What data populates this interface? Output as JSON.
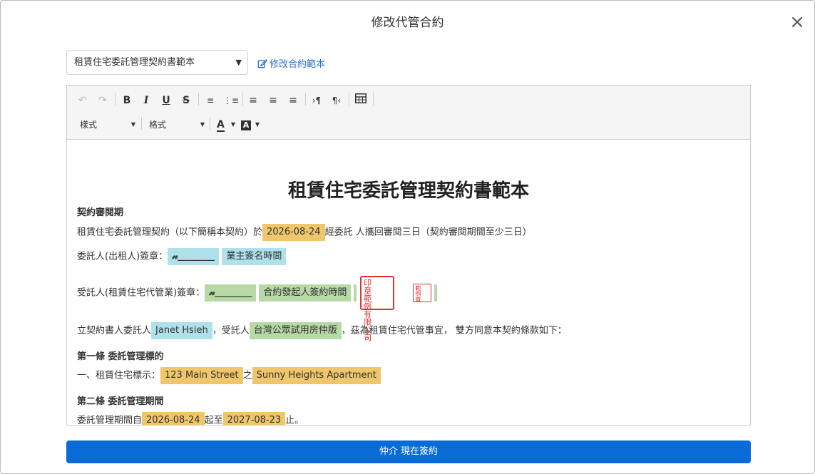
{
  "modal": {
    "title": "修改代管合約",
    "close": "×"
  },
  "template_select": {
    "value": "租賃住宅委託管理契約書範本",
    "edit_link": "修改合約範本"
  },
  "toolbar": {
    "style_dropdown": "樣式",
    "format_dropdown": "格式"
  },
  "document": {
    "title": "租賃住宅委託管理契約書範本",
    "review_heading": "契約審閱期",
    "review_text_1": "租賃住宅委託管理契約（以下簡稱本契約）於",
    "review_date": "2026-08-24",
    "review_text_2": "經委託 人攜回審閱三日（契約審閱期間至少三日）",
    "consignor_label": "委託人(出租人)簽章：",
    "consignor_sig": "𝓃________",
    "consignor_time": "業主簽名時間",
    "agent_label": "受託人(租賃住宅代管業)簽章：",
    "agent_sig": "𝓃________",
    "agent_time": "合約發起人簽約時間",
    "stamp_text": "公司印章範例有限",
    "stamp_small": "範例章",
    "parties_text_1": "立契約書人委託人",
    "consignor_name": "Janet Hsieh",
    "parties_text_2": "，受託人",
    "agent_name": "台灣公眾試用房仲版",
    "parties_text_3": "，茲為租賃住宅代管事宜， 雙方同意本契約條款如下：",
    "article1_heading": "第一條 委託管理標的",
    "article1_text_1": "一、租賃住宅標示：",
    "address": "123 Main Street",
    "article1_text_2": "之",
    "building": "Sunny Heights Apartment",
    "article2_heading": "第二條 委託管理期間",
    "article2_text_1": "委託管理期間自",
    "start_date": "2026-08-24",
    "article2_text_2": "起至",
    "end_date": "2027-08-23",
    "article2_text_3": "止。"
  },
  "submit_button": "仲介 現在簽約",
  "colors": {
    "primary": "#0a6bd6",
    "highlight_orange": "#f0c66a",
    "highlight_cyan": "#aee1ea",
    "highlight_green": "#b7d9a6",
    "stamp_red": "#d33333"
  }
}
